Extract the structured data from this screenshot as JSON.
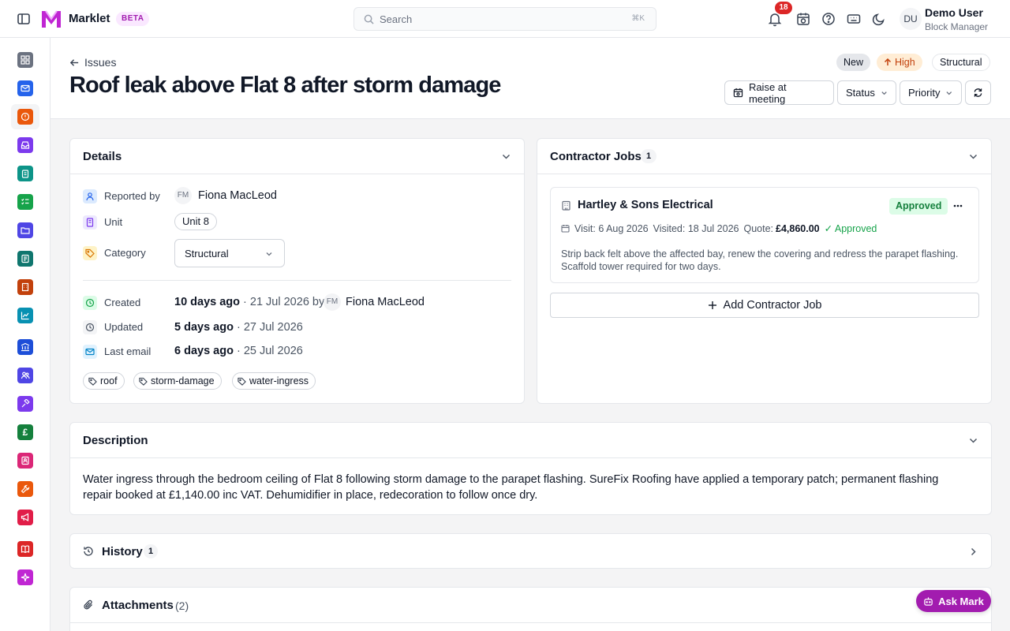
{
  "app": {
    "name": "Marklet",
    "badge": "BETA"
  },
  "search": {
    "placeholder": "Search",
    "shortcut": "⌘K"
  },
  "notifications": {
    "count": "18"
  },
  "user": {
    "initials": "DU",
    "name": "Demo User",
    "role": "Block Manager"
  },
  "rail": [
    {
      "name": "dashboard",
      "icon": "grid-icon",
      "color": "#6b7280"
    },
    {
      "name": "mail",
      "icon": "mail-icon",
      "color": "#2563eb"
    },
    {
      "name": "issues",
      "icon": "alert-icon",
      "color": "#ea580c",
      "active": true
    },
    {
      "name": "inbox",
      "icon": "inbox-icon",
      "color": "#7c3aed"
    },
    {
      "name": "tasks",
      "icon": "clipboard-icon",
      "color": "#0d9488"
    },
    {
      "name": "checklists",
      "icon": "checklist-icon",
      "color": "#16a34a"
    },
    {
      "name": "documents",
      "icon": "folder-icon",
      "color": "#4f46e5"
    },
    {
      "name": "reports",
      "icon": "report-icon",
      "color": "#0f766e"
    },
    {
      "name": "buildings",
      "icon": "building-icon",
      "color": "#c2410c"
    },
    {
      "name": "analytics",
      "icon": "chart-icon",
      "color": "#0891b2"
    },
    {
      "name": "bank",
      "icon": "bank-icon",
      "color": "#1d4ed8"
    },
    {
      "name": "people",
      "icon": "people-icon",
      "color": "#4f46e5"
    },
    {
      "name": "legal",
      "icon": "gavel-icon",
      "color": "#7c3aed"
    },
    {
      "name": "finance",
      "icon": "pound-icon",
      "color": "#15803d",
      "glyph": "£"
    },
    {
      "name": "contacts",
      "icon": "contact-icon",
      "color": "#db2777"
    },
    {
      "name": "contractors",
      "icon": "wrench-icon",
      "color": "#ea580c"
    },
    {
      "name": "announcements",
      "icon": "megaphone-icon",
      "color": "#e11d48"
    },
    {
      "name": "knowledge",
      "icon": "book-icon",
      "color": "#dc2626"
    },
    {
      "name": "ai-assistant",
      "icon": "sparkle-icon",
      "color": "#c026d3"
    }
  ],
  "page": {
    "back_label": "Issues",
    "title": "Roof leak above Flat 8 after storm damage",
    "status_chip": "New",
    "priority_chip": "High",
    "category_chip": "Structural",
    "actions": {
      "raise": "Raise at meeting",
      "status": "Status",
      "priority": "Priority"
    }
  },
  "details": {
    "title": "Details",
    "reported_by_label": "Reported by",
    "reporter_initials": "FM",
    "reporter_name": "Fiona MacLeod",
    "unit_label": "Unit",
    "unit_value": "Unit 8",
    "category_label": "Category",
    "category_value": "Structural",
    "created_label": "Created",
    "created_rel": "10 days ago",
    "created_date": " · 21 Jul 2026 by ",
    "creator_initials": "FM",
    "creator_name": "Fiona MacLeod",
    "updated_label": "Updated",
    "updated_rel": "5 days ago",
    "updated_date": " · 27 Jul 2026",
    "email_label": "Last email",
    "email_rel": "6 days ago",
    "email_date": " · 25 Jul 2026",
    "tags": [
      "roof",
      "storm-damage",
      "water-ingress"
    ]
  },
  "contractor_jobs": {
    "title": "Contractor Jobs",
    "count": "1",
    "job": {
      "contractor": "Hartley & Sons Electrical",
      "status": "Approved",
      "visit": "Visit: 6 Aug 2026",
      "visited": "Visited: 18 Jul 2026",
      "quote_label": "Quote:",
      "quote_value": "£4,860.00",
      "quote_status": "✓ Approved",
      "description": "Strip back felt above the affected bay, renew the covering and redress the parapet flashing. Scaffold tower required for two days."
    },
    "add_label": "Add Contractor Job"
  },
  "description": {
    "title": "Description",
    "text": "Water ingress through the bedroom ceiling of Flat 8 following storm damage to the parapet flashing. SureFix Roofing have applied a temporary patch; permanent flashing repair booked at £1,140.00 inc VAT. Dehumidifier in place, redecoration to follow once dry."
  },
  "history": {
    "title": "History",
    "count": "1"
  },
  "attachments": {
    "title": "Attachments",
    "count": "(2)"
  },
  "assistant": {
    "label": "Ask Mark"
  },
  "colors": {
    "brand": "#a21caf",
    "approved": "#16a34a",
    "high": "#c2410c",
    "badge_red": "#dc2626"
  }
}
